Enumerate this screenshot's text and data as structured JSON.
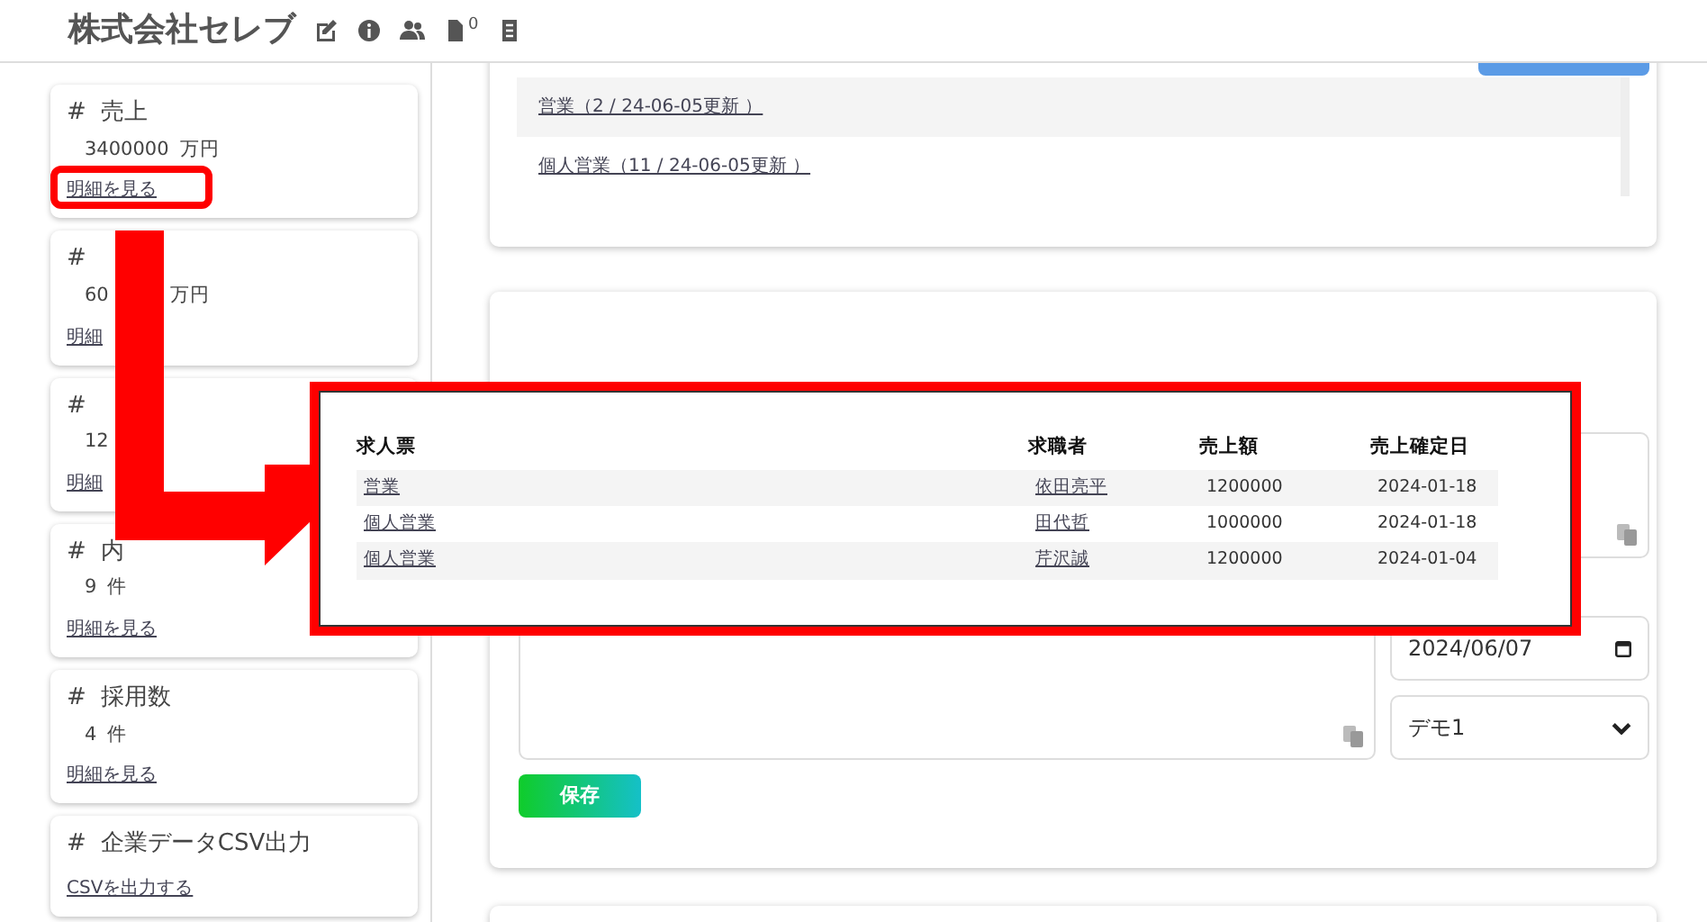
{
  "header": {
    "title": "株式会社セレブ",
    "badge": "0"
  },
  "sidebar": {
    "cards": [
      {
        "mark": "#",
        "title": "売上",
        "value": "3400000",
        "unit": "万円",
        "link": "明細を見る"
      },
      {
        "mark": "#",
        "value": "60",
        "unit": "万円",
        "link": "明細"
      },
      {
        "mark": "#",
        "value": "12",
        "link": "明細"
      },
      {
        "mark": "#",
        "title": "内",
        "value": "9",
        "unit": "件",
        "link": "明細を見る"
      },
      {
        "mark": "#",
        "title": "採用数",
        "value": "4",
        "unit": "件",
        "link": "明細を見る"
      },
      {
        "mark": "#",
        "title": "企業データCSV出力",
        "link": "CSVを出力する"
      }
    ]
  },
  "job_list": {
    "items": [
      "営業（2 / 24-06-05更新 ）",
      "個人営業（11 / 24-06-05更新 ）"
    ]
  },
  "action_form": {
    "date": "2024/06/07",
    "staff": "デモ1",
    "save": "保存"
  },
  "popup": {
    "columns": [
      "求人票",
      "求職者",
      "売上額",
      "売上確定日"
    ],
    "rows": [
      [
        "営業",
        "依田亮平",
        "1200000",
        "2024-01-18"
      ],
      [
        "個人営業",
        "田代哲",
        "1000000",
        "2024-01-18"
      ],
      [
        "個人営業",
        "芹沢誠",
        "1200000",
        "2024-01-04"
      ]
    ]
  }
}
